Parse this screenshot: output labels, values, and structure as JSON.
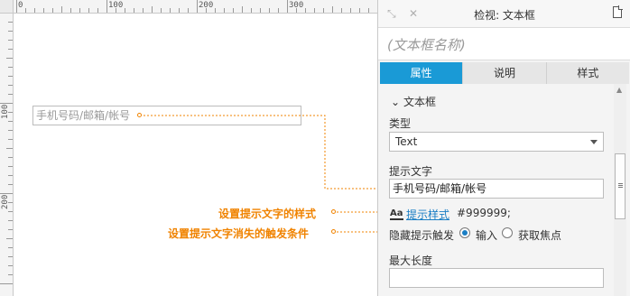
{
  "ruler": {
    "top_ticks": [
      "0",
      "100",
      "200",
      "300"
    ],
    "left_ticks": [
      "100",
      "200"
    ]
  },
  "canvas": {
    "placeholder_text": "手机号码/邮箱/帐号"
  },
  "annotations": {
    "style_note": "设置提示文字的样式",
    "trigger_note": "设置提示文字消失的触发条件"
  },
  "panel": {
    "title": "检视: 文本框",
    "name_placeholder": "(文本框名称)",
    "tabs": [
      {
        "label": "属性",
        "active": true
      },
      {
        "label": "说明",
        "active": false
      },
      {
        "label": "样式",
        "active": false
      }
    ],
    "section_title": "文本框",
    "type_label": "类型",
    "type_value": "Text",
    "hint_label": "提示文字",
    "hint_value": "手机号码/邮箱/帐号",
    "hint_style_link": "提示样式",
    "hint_style_value": "#999999;",
    "hide_label": "隐藏提示触发",
    "radio_options": [
      {
        "label": "输入",
        "checked": true
      },
      {
        "label": "获取焦点",
        "checked": false
      }
    ],
    "maxlen_label": "最大长度",
    "maxlen_value": ""
  },
  "colors": {
    "accent": "#1a9ad6",
    "annotation": "#f08300",
    "placeholder": "#999999"
  },
  "icons": [
    "back-arrow-icon",
    "close-icon",
    "page-icon",
    "chevron-down-icon",
    "text-style-icon"
  ]
}
